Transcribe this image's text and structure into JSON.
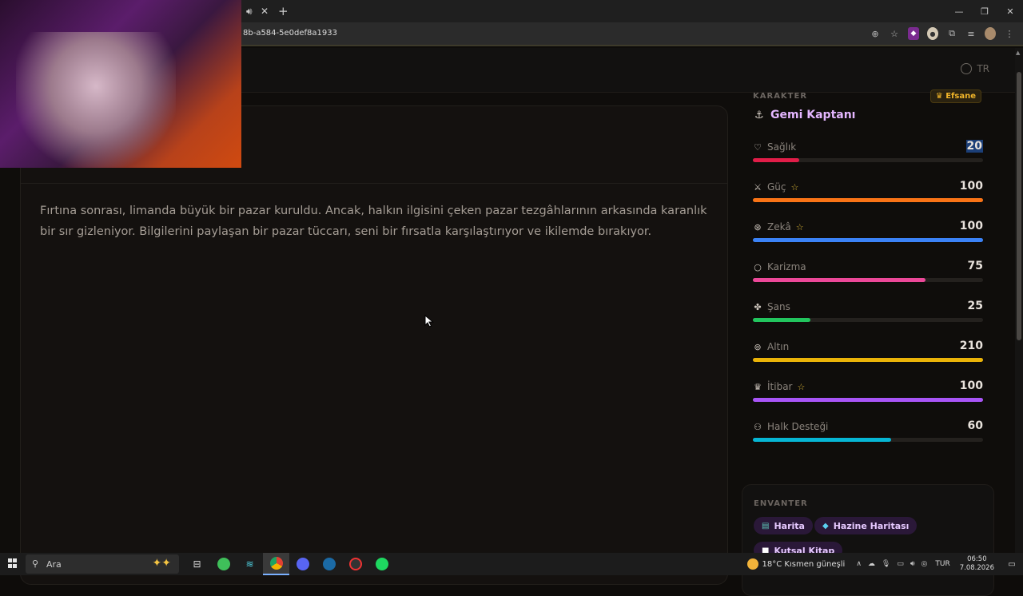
{
  "browser": {
    "url": "8b-a584-5e0def8a1933",
    "tab_close": "✕",
    "new_tab": "+"
  },
  "header": {
    "language": "TR"
  },
  "story": {
    "text": "Fırtına sonrası, limanda büyük bir pazar kuruldu. Ancak, halkın ilgisini çeken pazar tezgâhlarının arkasında karanlık bir sır gizleniyor. Bilgilerini paylaşan bir pazar tüccarı, seni bir fırsatla karşılaştırıyor ve ikilemde bırakıyor."
  },
  "character": {
    "section_label": "KARAKTER",
    "badge": "Efsane",
    "name": "Gemi Kaptanı",
    "stats": [
      {
        "label": "Sağlık",
        "value": "20",
        "fraction": 0.2,
        "color": "#e11d48",
        "starred": false,
        "icon": "heart-icon"
      },
      {
        "label": "Güç",
        "value": "100",
        "fraction": 1.0,
        "color": "#f97316",
        "starred": true,
        "icon": "sword-icon"
      },
      {
        "label": "Zekâ",
        "value": "100",
        "fraction": 1.0,
        "color": "#3b82f6",
        "starred": true,
        "icon": "brain-icon"
      },
      {
        "label": "Karizma",
        "value": "75",
        "fraction": 0.75,
        "color": "#ec4899",
        "starred": false,
        "icon": "speech-bubble-icon"
      },
      {
        "label": "Şans",
        "value": "25",
        "fraction": 0.25,
        "color": "#22c55e",
        "starred": false,
        "icon": "clover-icon"
      },
      {
        "label": "Altın",
        "value": "210",
        "fraction": 1.0,
        "color": "#eab308",
        "starred": false,
        "icon": "coins-icon"
      },
      {
        "label": "İtibar",
        "value": "100",
        "fraction": 1.0,
        "color": "#a855f7",
        "starred": true,
        "icon": "crown-icon"
      },
      {
        "label": "Halk Desteği",
        "value": "60",
        "fraction": 0.6,
        "color": "#06b6d4",
        "starred": false,
        "icon": "people-icon"
      }
    ]
  },
  "inventory": {
    "section_label": "ENVANTER",
    "items": [
      {
        "label": "Harita",
        "icon": "map-icon"
      },
      {
        "label": "Hazine Haritası",
        "icon": "gem-icon"
      },
      {
        "label": "Kutsal Kitap",
        "icon": "book-icon"
      }
    ]
  },
  "taskbar": {
    "search_placeholder": "Ara",
    "weather": "18°C  Kısmen güneşli",
    "lang": "TUR",
    "time": "06:50",
    "date": "7.08.2026"
  }
}
